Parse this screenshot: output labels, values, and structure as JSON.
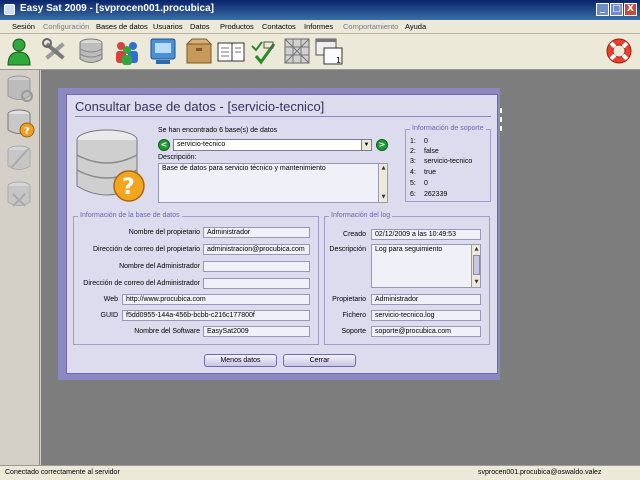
{
  "window": {
    "title": "Easy Sat 2009 - [svprocen001.procubica]",
    "buttons": [
      "_",
      "□",
      "X"
    ]
  },
  "menu": [
    "Sesión",
    "Configuración",
    "Bases de datos",
    "Usuarios",
    "Datos",
    "Productos",
    "Contactos",
    "Informes",
    "Comportamiento",
    "Ayuda"
  ],
  "toolbar": {
    "icons": [
      "user-icon",
      "tools-icon",
      "database-icon",
      "users-group-icon",
      "computer-icon",
      "box-icon",
      "book-icon",
      "checklist-icon",
      "network-icon",
      "window-icon",
      "help-lifebuoy-icon"
    ]
  },
  "sidebar": {
    "icons": [
      "database-search-icon",
      "database-question-icon",
      "database-remove-icon",
      "database-disabled-icon"
    ]
  },
  "dialog": {
    "title": "Consultar base de datos - [servicio-tecnico]",
    "found_text": "Se han encontrado 6 base(s) de datos",
    "selected_db": "servicio-tecnico",
    "prev_label": "<",
    "next_label": ">",
    "description_label": "Descripción:",
    "description_value": "Base de datos para servicio técnico y mantenimiento",
    "support": {
      "legend": "Información de soporte",
      "rows": [
        {
          "k": "1:",
          "v": "0"
        },
        {
          "k": "2:",
          "v": "false"
        },
        {
          "k": "3:",
          "v": "servicio-tecnico"
        },
        {
          "k": "4:",
          "v": "true"
        },
        {
          "k": "5:",
          "v": "0"
        },
        {
          "k": "6:",
          "v": "262339"
        }
      ]
    },
    "dbinfo": {
      "legend": "Información de la base de datos",
      "owner_name_label": "Nombre del propietario",
      "owner_name": "Administrador",
      "owner_email_label": "Dirección de correo del propietario",
      "owner_email": "administracion@procubica.com",
      "admin_name_label": "Nombre del Administrador",
      "admin_name": "",
      "admin_email_label": "Dirección de correo del Administrador",
      "admin_email": "",
      "web_label": "Web",
      "web": "http://www.procubica.com",
      "guid_label": "GUID",
      "guid": "f5dd0955-144a-456b-bcbb-c216c177800f",
      "software_label": "Nombre del Software",
      "software": "EasySat2009"
    },
    "log": {
      "legend": "Información del log",
      "created_label": "Creado",
      "created": "02/12/2009 a las 10:49:53",
      "desc_label": "Descripción",
      "desc": "Log para seguimiento",
      "owner_label": "Propietario",
      "owner": "Administrador",
      "file_label": "Fichero",
      "file": "servicio-tecnico.log",
      "support_label": "Soporte",
      "support": "soporte@procubica.com"
    },
    "less_button": "Menos datos",
    "close_button": "Cerrar"
  },
  "status": {
    "left": "Conectado correctamente al servidor",
    "right": "svprocen001.procubica@oswaldo.valez"
  }
}
